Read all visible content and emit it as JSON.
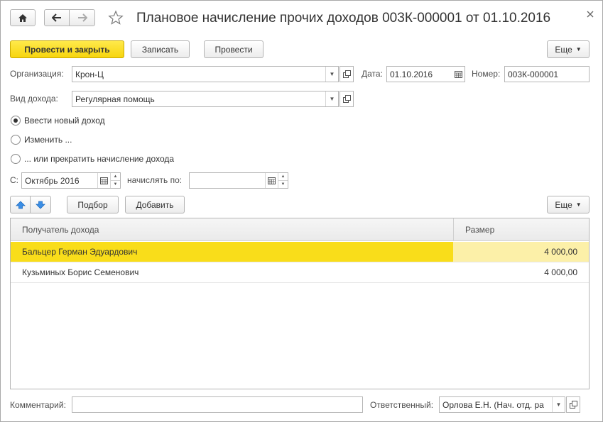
{
  "window": {
    "title": "Плановое начисление прочих доходов 003К-000001 от 01.10.2016"
  },
  "toolbar": {
    "post_close_label": "Провести и закрыть",
    "save_label": "Записать",
    "post_label": "Провести",
    "more_label": "Еще"
  },
  "form": {
    "org_label": "Организация:",
    "org_value": "Крон-Ц",
    "date_label": "Дата:",
    "date_value": "01.10.2016",
    "number_label": "Номер:",
    "number_value": "003К-000001",
    "income_type_label": "Вид дохода:",
    "income_type_value": "Регулярная помощь",
    "radios": [
      {
        "label": "Ввести новый доход",
        "checked": true
      },
      {
        "label": "Изменить ...",
        "checked": false
      },
      {
        "label": "... или прекратить начисление дохода",
        "checked": false
      }
    ],
    "from_label": "С:",
    "from_value": "Октябрь 2016",
    "accrue_until_label": "начислять по:",
    "accrue_until_value": ""
  },
  "table_toolbar": {
    "pick_label": "Подбор",
    "add_label": "Добавить",
    "more_label": "Еще"
  },
  "table": {
    "columns": [
      "Получатель дохода",
      "Размер"
    ],
    "rows": [
      {
        "recipient": "Бальцер Герман Эдуардович",
        "amount": "4 000,00",
        "selected": true
      },
      {
        "recipient": "Кузьминых Борис Семенович",
        "amount": "4 000,00",
        "selected": false
      }
    ]
  },
  "footer": {
    "comment_label": "Комментарий:",
    "comment_value": "",
    "responsible_label": "Ответственный:",
    "responsible_value": "Орлова Е.Н. (Нач. отд. ра"
  },
  "colors": {
    "accent_yellow": "#f9dd1a",
    "selected_cell": "#fcf0a8",
    "arrow_blue": "#3a8ee6"
  }
}
